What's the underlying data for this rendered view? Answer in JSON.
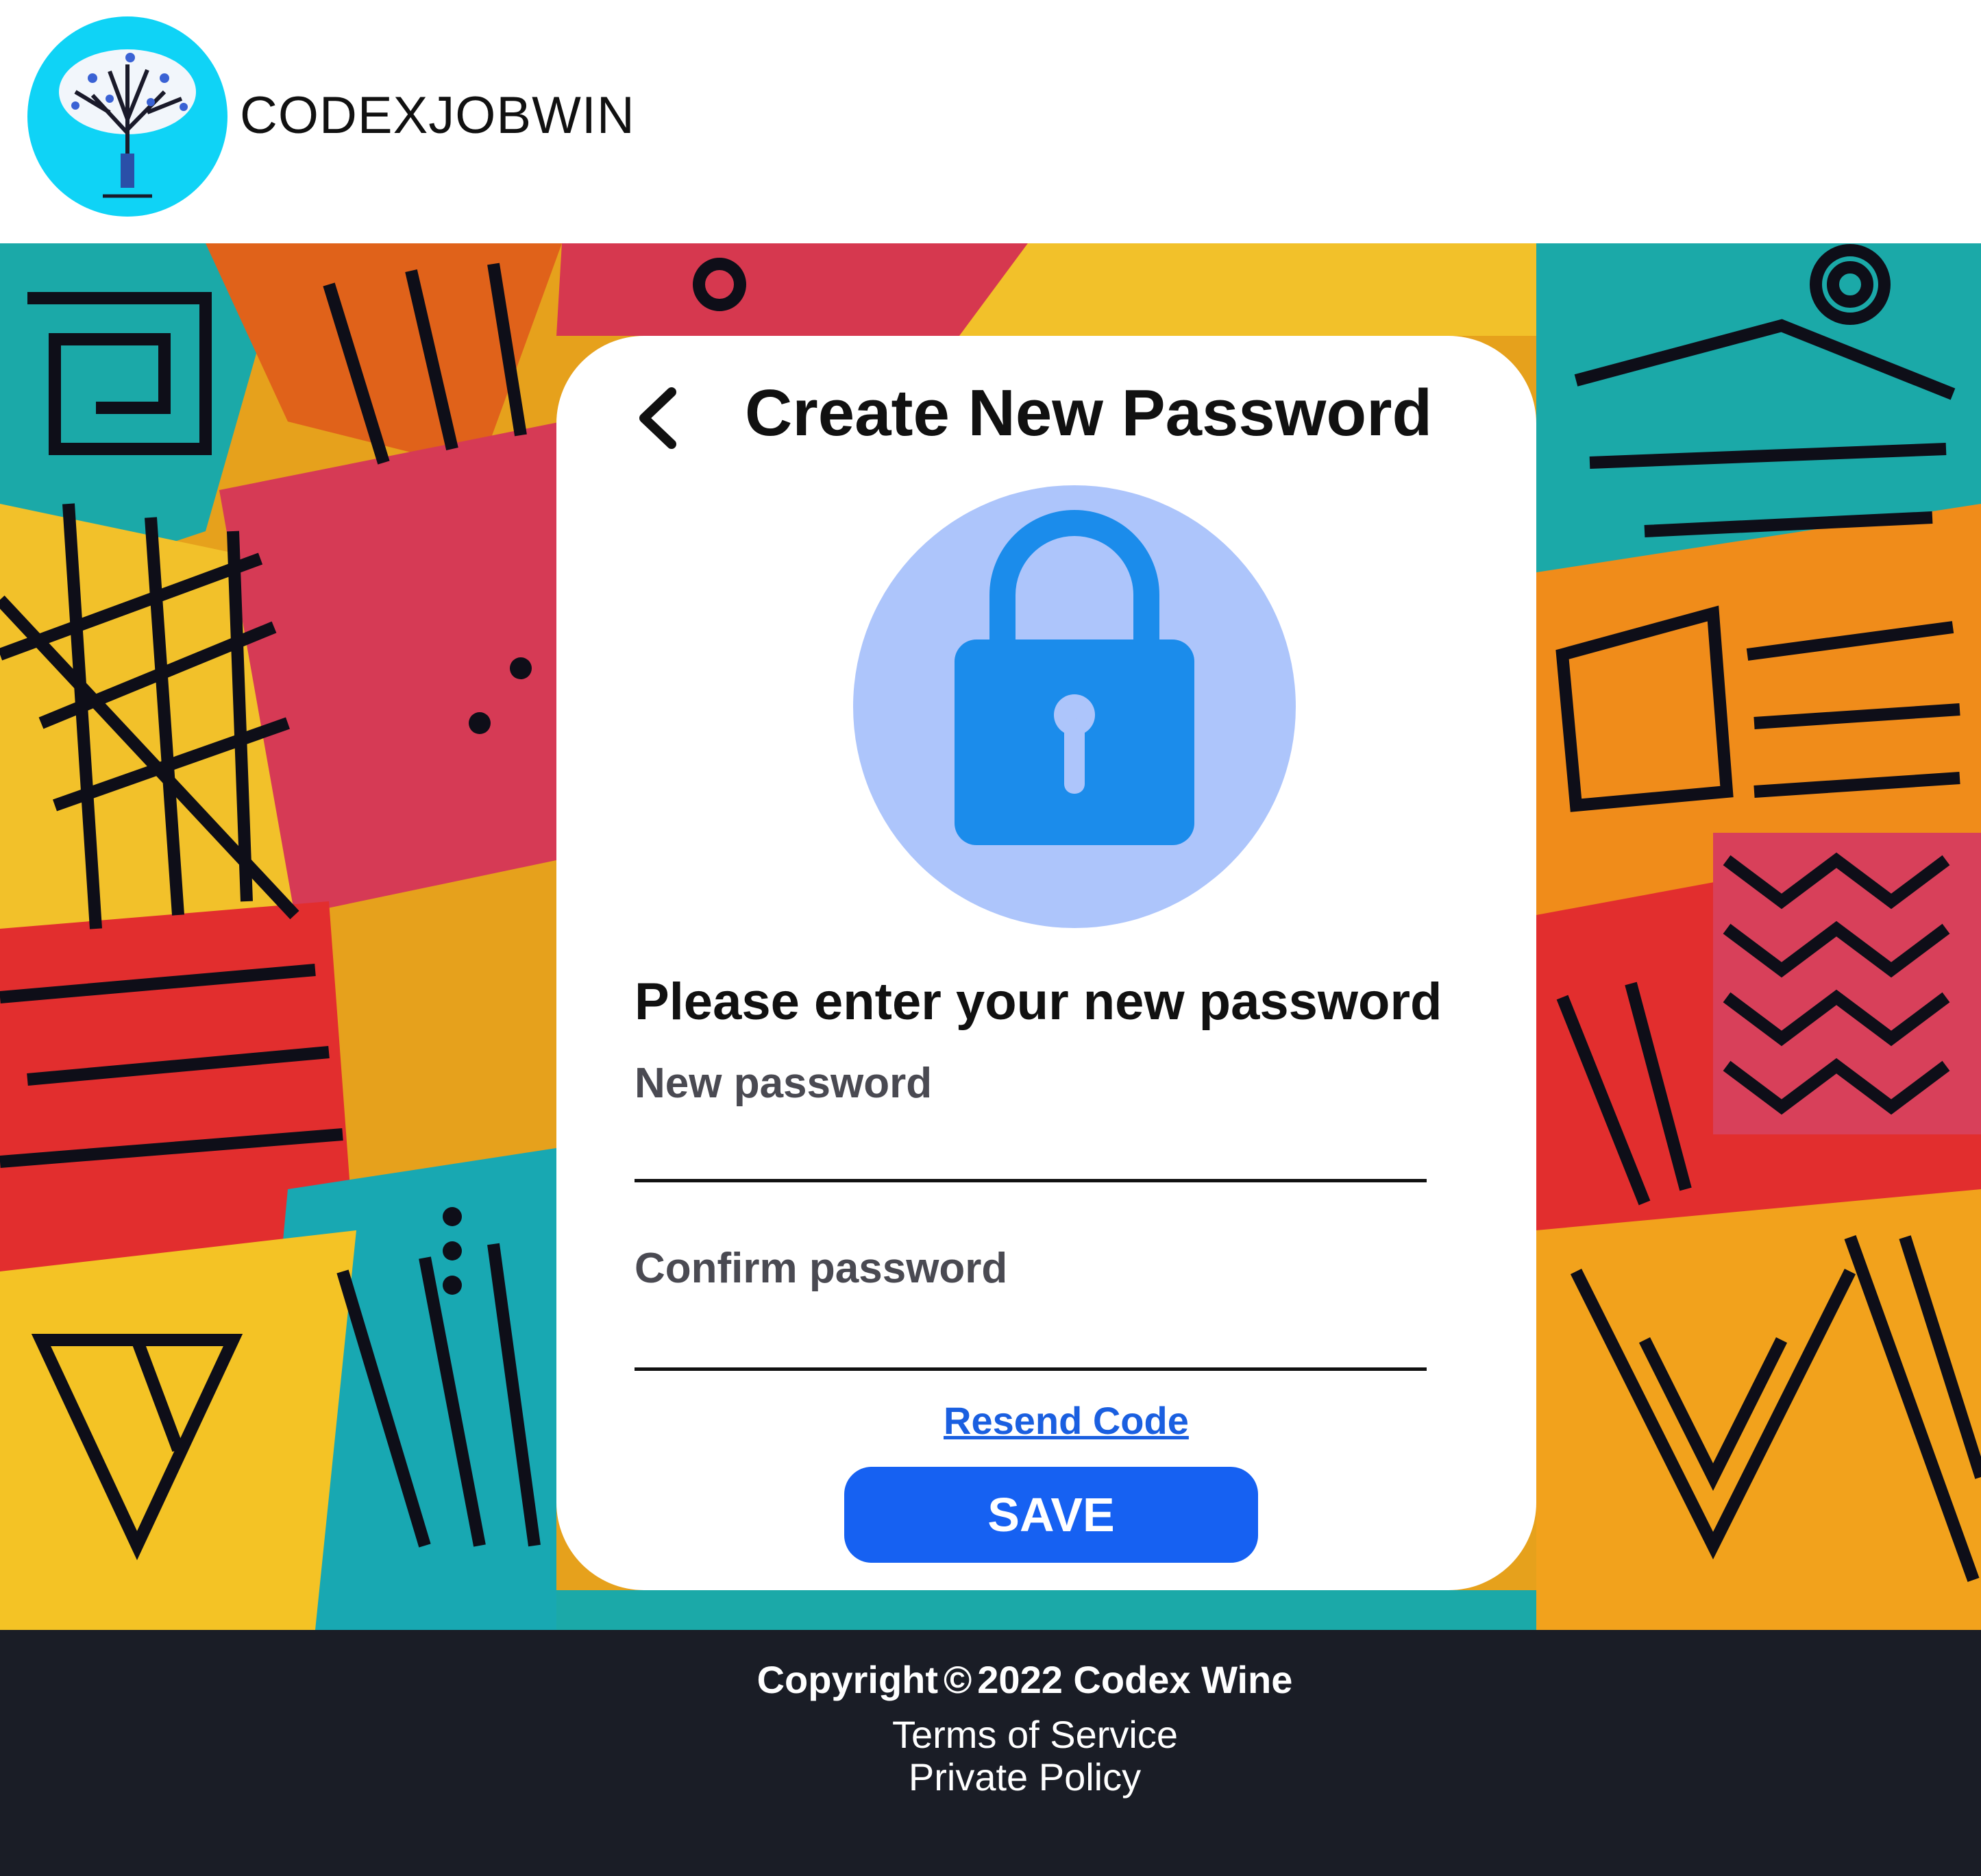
{
  "header": {
    "brand": "CODEXJOBWIN",
    "logo_icon": "tree-logo-icon"
  },
  "card": {
    "title": "Create New Password",
    "back_icon": "chevron-left-icon",
    "lock_icon": "padlock-icon",
    "subtitle": "Please enter your new password",
    "new_password_label": "New password",
    "new_password_value": "",
    "confirm_password_label": "Confirm password",
    "confirm_password_value": "",
    "resend_label": "Resend Code",
    "save_label": "SAVE"
  },
  "footer": {
    "copyright_prefix": "Copyright",
    "copyright_symbol": "©",
    "copyright_text": "2022 Codex Wine",
    "terms": "Terms of Service",
    "privacy": "Private Policy"
  },
  "colors": {
    "accent": "#1661f2",
    "link": "#1a5fe0",
    "lock_bg": "#adc5fb",
    "lock": "#1b8ceb",
    "logo_bg": "#0fd3f6",
    "footer_bg": "#1a1d26"
  }
}
